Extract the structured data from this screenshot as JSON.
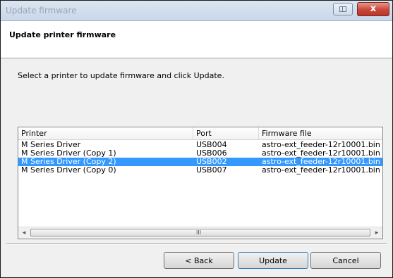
{
  "window": {
    "title": "Update firmware",
    "close_label": "x"
  },
  "header": {
    "title": "Update printer firmware"
  },
  "instructions": "Select a printer to update firmware and click Update.",
  "list": {
    "columns": [
      "Printer",
      "Port",
      "Firmware file"
    ],
    "rows": [
      {
        "printer": "M Series Driver",
        "port": "USB004",
        "firmware": "astro-ext_feeder-12r10001.bin",
        "selected": false
      },
      {
        "printer": "M Series Driver (Copy 1)",
        "port": "USB006",
        "firmware": "astro-ext_feeder-12r10001.bin",
        "selected": false
      },
      {
        "printer": "M Series Driver (Copy 2)",
        "port": "USB002",
        "firmware": "astro-ext_feeder-12r10001.bin",
        "selected": true
      },
      {
        "printer": "M Series Driver (Copy 0)",
        "port": "USB007",
        "firmware": "astro-ext_feeder-12r10001.bin",
        "selected": false
      }
    ],
    "scroll_left_glyph": "◂",
    "scroll_right_glyph": "▸",
    "scroll_grip": "III"
  },
  "buttons": {
    "back": "< Back",
    "update": "Update",
    "cancel": "Cancel"
  },
  "colors": {
    "selection": "#3399ff",
    "close_button": "#c9473a"
  }
}
